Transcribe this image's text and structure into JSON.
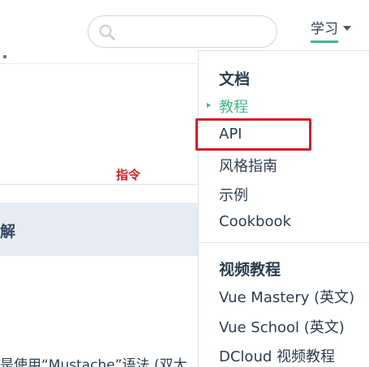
{
  "header": {
    "search": {
      "placeholder": "",
      "icon": "search-icon"
    },
    "learn_nav": {
      "label": "学习",
      "icon": "chevron-down-icon",
      "underline_color": "#42b983"
    }
  },
  "content": {
    "directive_label": "指令",
    "highlight_text": "解",
    "bottom_text": "是使用“Mustache”语法 (双大"
  },
  "dropdown": {
    "groups": [
      {
        "title": "文档",
        "items": [
          {
            "label": "教程",
            "active": true
          },
          {
            "label": "API"
          },
          {
            "label": "风格指南"
          },
          {
            "label": "示例"
          },
          {
            "label": "Cookbook"
          }
        ]
      },
      {
        "title": "视频教程",
        "items": [
          {
            "label": "Vue Mastery (英文)"
          },
          {
            "label": "Vue School (英文)"
          },
          {
            "label": "DCloud 视频教程"
          }
        ]
      }
    ]
  },
  "colors": {
    "accent": "#42b983",
    "text": "#2c3e50",
    "annotation": "#d1202a",
    "highlight_bg": "#e7ecf3"
  }
}
